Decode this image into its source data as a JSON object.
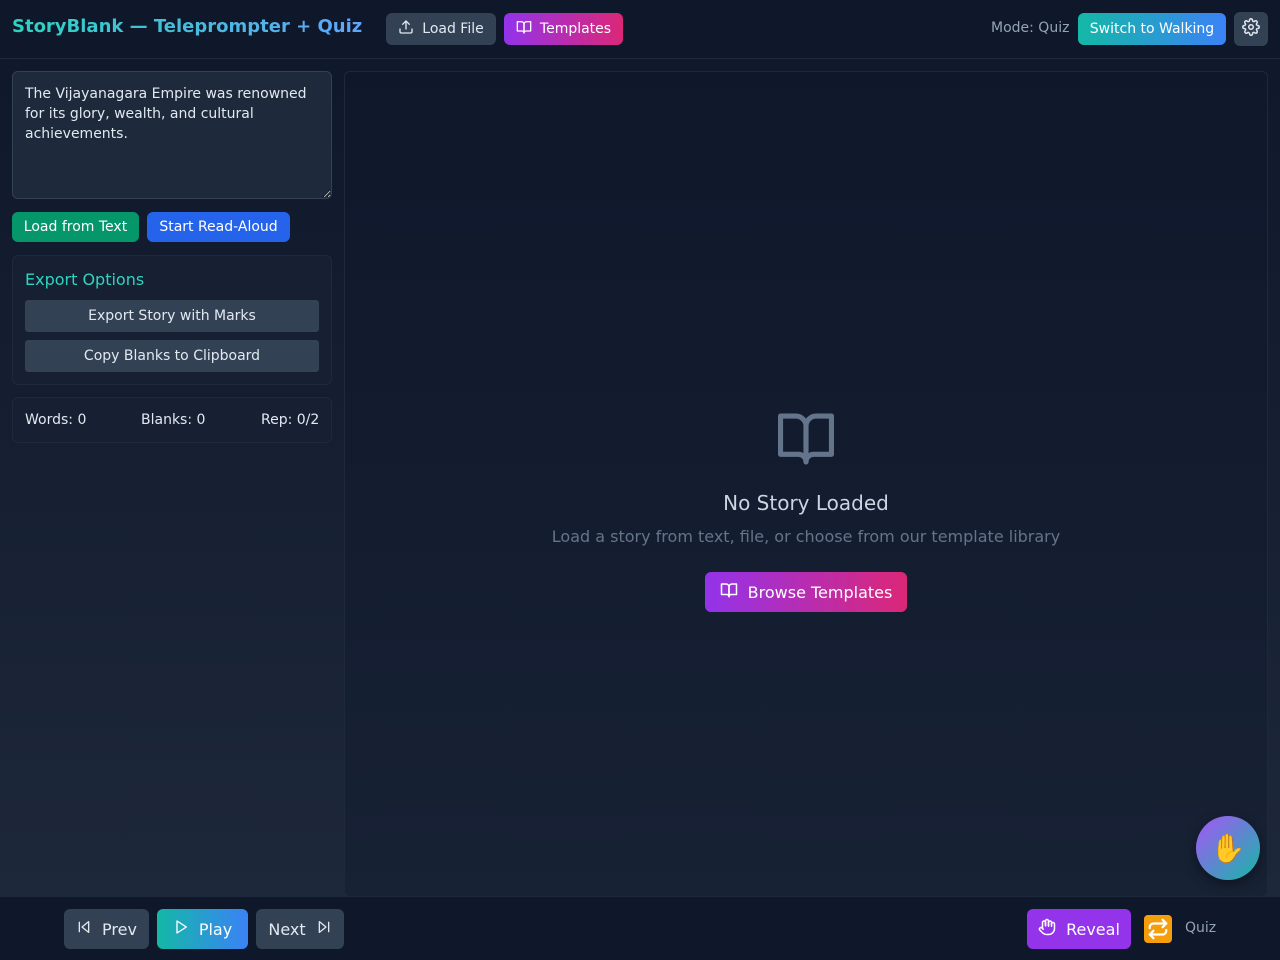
{
  "header": {
    "title": "StoryBlank — Teleprompter + Quiz",
    "load_file_label": "Load File",
    "templates_label": "Templates",
    "mode_label": "Mode: Quiz",
    "switch_label": "Switch to Walking"
  },
  "sidebar": {
    "story_text": "The Vijayanagara Empire was renowned for its glory, wealth, and cultural achievements.",
    "load_text_label": "Load from Text",
    "read_aloud_label": "Start Read-Aloud",
    "export": {
      "title": "Export Options",
      "export_story_label": "Export Story with Marks",
      "copy_blanks_label": "Copy Blanks to Clipboard"
    },
    "stats": {
      "words": "Words: 0",
      "blanks": "Blanks: 0",
      "rep": "Rep: 0/2"
    }
  },
  "main": {
    "empty_title": "No Story Loaded",
    "empty_subtitle": "Load a story from text, file, or choose from our template library",
    "browse_label": "Browse Templates"
  },
  "fab": {
    "icon": "✋"
  },
  "footer": {
    "prev_label": "Prev",
    "play_label": "Play",
    "next_label": "Next",
    "reveal_label": "Reveal",
    "quiz_label": "Quiz"
  },
  "colors": {
    "accent_teal": "#14b8a6",
    "accent_blue": "#3b82f6",
    "accent_purple": "#9333ea",
    "accent_pink": "#db2777",
    "green": "#059669",
    "background": "#0f172a"
  },
  "icons": {
    "upload": "upload-icon",
    "book": "book-open-icon",
    "settings": "gear-icon",
    "prev": "skip-back-icon",
    "play": "play-icon",
    "next": "skip-forward-icon",
    "reveal": "hand-icon",
    "repeat": "repeat-icon",
    "fab": "raised-hand-icon"
  }
}
